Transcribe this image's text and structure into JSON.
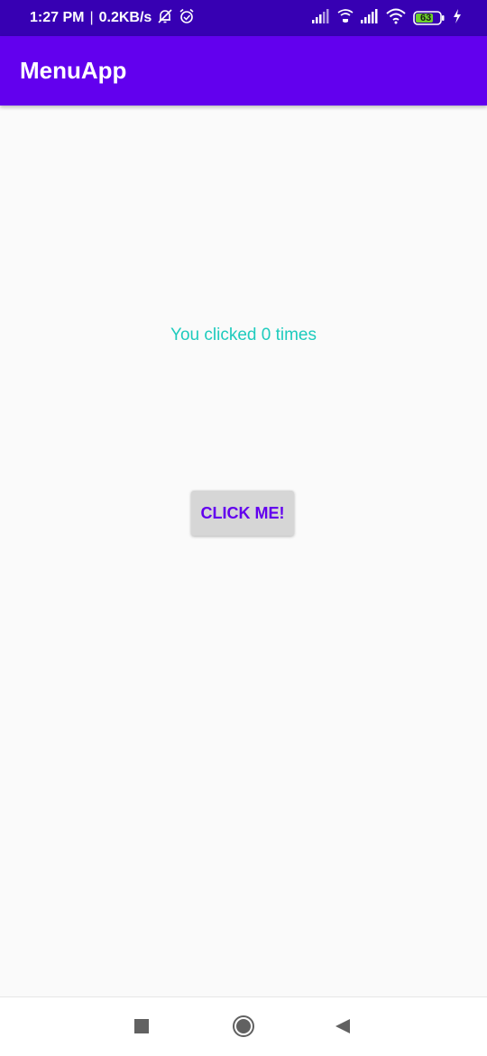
{
  "status_bar": {
    "time": "1:27 PM",
    "separator": "|",
    "net_speed": "0.2KB/s",
    "battery_level": "63",
    "icons": [
      "mute-bell-icon",
      "alarm-icon",
      "signal-icon",
      "wifi-calling-icon",
      "signal-icon",
      "wifi-icon",
      "battery-icon",
      "charging-icon"
    ]
  },
  "app_bar": {
    "title": "MenuApp"
  },
  "main": {
    "counter_text": "You clicked 0 times",
    "button_label": "CLICK ME!"
  },
  "nav_bar": {
    "icons": [
      "recents-icon",
      "home-icon",
      "back-icon"
    ]
  },
  "colors": {
    "status_bar": "#3700B3",
    "app_bar": "#6200EE",
    "counter_text": "#1ECBBD",
    "button_bg": "#D6D6D6",
    "button_text": "#6200EE",
    "background": "#FAFAFA",
    "battery_fill": "#6BD12B"
  }
}
